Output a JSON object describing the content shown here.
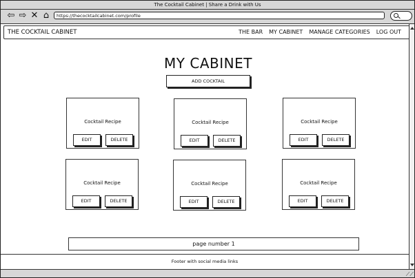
{
  "window": {
    "title": "The Cocktail Cabinet | Share a Drink with Us",
    "url": "https://thecocktailcabinet.com/profile"
  },
  "browser_icons": {
    "back": "back-arrow-icon",
    "forward": "forward-arrow-icon",
    "stop": "stop-icon",
    "home": "home-icon",
    "search": "search-icon"
  },
  "nav": {
    "brand": "THE COCKTAIL CABINET",
    "links": [
      "THE BAR",
      "MY CABINET",
      "MANAGE CATEGORIES",
      "LOG OUT"
    ]
  },
  "main": {
    "title": "MY CABINET",
    "add_button": "ADD COCKTAIL",
    "cards": [
      {
        "label": "Cocktail Recipe",
        "edit": "EDIT",
        "delete": "DELETE"
      },
      {
        "label": "Cocktail Recipe",
        "edit": "EDIT",
        "delete": "DELETE"
      },
      {
        "label": "Cocktail Recipe",
        "edit": "EDIT",
        "delete": "DELETE"
      },
      {
        "label": "Cocktail Recipe",
        "edit": "EDIT",
        "delete": "DELETE"
      },
      {
        "label": "Cocktail Recipe",
        "edit": "EDIT",
        "delete": "DELETE"
      },
      {
        "label": "Cocktail Recipe",
        "edit": "EDIT",
        "delete": "DELETE"
      }
    ],
    "pagination": "page number 1"
  },
  "footer": {
    "text": "Footer with social media links"
  }
}
